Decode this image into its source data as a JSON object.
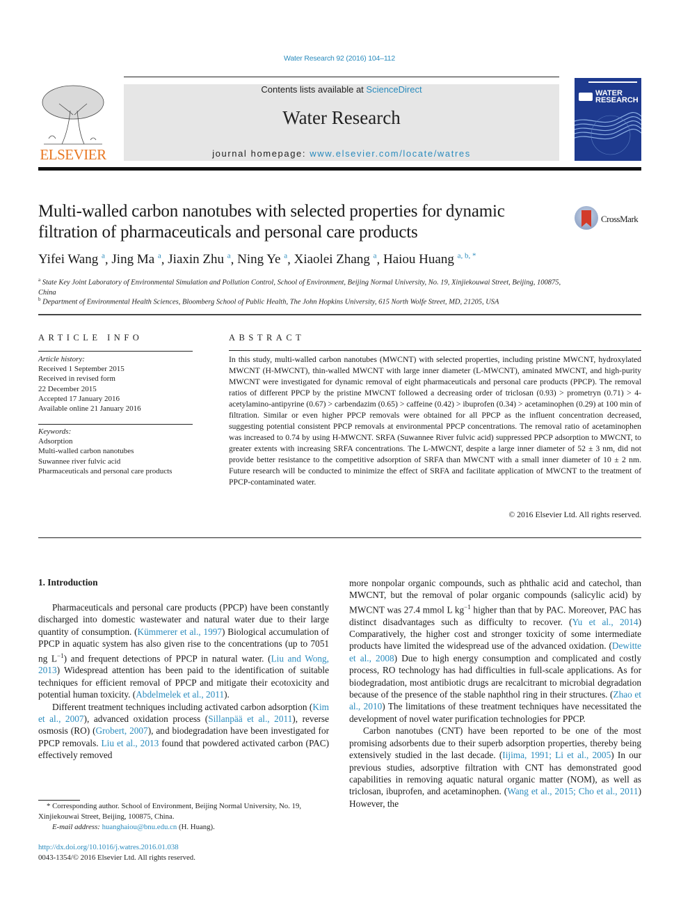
{
  "header": {
    "journal_citation": "Water Research 92 (2016) 104–112",
    "contents_prefix": "Contents lists available at ",
    "contents_link": "ScienceDirect",
    "journal_title": "Water Research",
    "homepage_prefix": "journal homepage: ",
    "homepage_link": "www.elsevier.com/locate/watres",
    "publisher_logo_text": "ELSEVIER",
    "cover_title_line1": "WATER",
    "cover_title_line2": "RESEARCH",
    "crossmark_label": "CrossMark"
  },
  "article": {
    "title": "Multi-walled carbon nanotubes with selected properties for dynamic filtration of pharmaceuticals and personal care products",
    "authors": [
      {
        "name": "Yifei Wang",
        "aff": "a"
      },
      {
        "name": "Jing Ma",
        "aff": "a"
      },
      {
        "name": "Jiaxin Zhu",
        "aff": "a"
      },
      {
        "name": "Ning Ye",
        "aff": "a"
      },
      {
        "name": "Xiaolei Zhang",
        "aff": "a"
      },
      {
        "name": "Haiou Huang",
        "aff": "a, b, *"
      }
    ],
    "affiliations": [
      {
        "key": "a",
        "text": "State Key Joint Laboratory of Environmental Simulation and Pollution Control, School of Environment, Beijing Normal University, No. 19, Xinjiekouwai Street, Beijing, 100875, China"
      },
      {
        "key": "b",
        "text": "Department of Environmental Health Sciences, Bloomberg School of Public Health, The John Hopkins University, 615 North Wolfe Street, MD, 21205, USA"
      }
    ]
  },
  "article_info": {
    "heading": "ARTICLE INFO",
    "history_label": "Article history:",
    "history": [
      "Received 1 September 2015",
      "Received in revised form",
      "22 December 2015",
      "Accepted 17 January 2016",
      "Available online 21 January 2016"
    ],
    "keywords_label": "Keywords:",
    "keywords": [
      "Adsorption",
      "Multi-walled carbon nanotubes",
      "Suwannee river fulvic acid",
      "Pharmaceuticals and personal care products"
    ]
  },
  "abstract": {
    "heading": "ABSTRACT",
    "text": "In this study, multi-walled carbon nanotubes (MWCNT) with selected properties, including pristine MWCNT, hydroxylated MWCNT (H-MWCNT), thin-walled MWCNT with large inner diameter (L-MWCNT), aminated MWCNT, and high-purity MWCNT were investigated for dynamic removal of eight pharmaceuticals and personal care products (PPCP). The removal ratios of different PPCP by the pristine MWCNT followed a decreasing order of triclosan (0.93) > prometryn (0.71) > 4-acetylamino-antipyrine (0.67) > carbendazim (0.65) > caffeine (0.42) > ibuprofen (0.34) > acetaminophen (0.29) at 100 min of filtration. Similar or even higher PPCP removals were obtained for all PPCP as the influent concentration decreased, suggesting potential consistent PPCP removals at environmental PPCP concentrations. The removal ratio of acetaminophen was increased to 0.74 by using H-MWCNT. SRFA (Suwannee River fulvic acid) suppressed PPCP adsorption to MWCNT, to greater extents with increasing SRFA concentrations. The L-MWCNT, despite a large inner diameter of 52 ± 3 nm, did not provide better resistance to the competitive adsorption of SRFA than MWCNT with a small inner diameter of 10 ± 2 nm. Future research will be conducted to minimize the effect of SRFA and facilitate application of MWCNT to the treatment of PPCP-contaminated water.",
    "copyright": "© 2016 Elsevier Ltd. All rights reserved."
  },
  "introduction": {
    "heading": "1.  Introduction",
    "left_paragraphs": [
      [
        {
          "t": "Pharmaceuticals and personal care products (PPCP) have been constantly discharged into domestic wastewater and natural water due to their large quantity of consumption. ("
        },
        {
          "l": "Kümmerer et al., 1997"
        },
        {
          "t": ") Biological accumulation of PPCP in aquatic system has also given rise to the concentrations (up to 7051 ng L"
        },
        {
          "sup": "−1"
        },
        {
          "t": ") and frequent detections of PPCP in natural water. ("
        },
        {
          "l": "Liu and Wong, 2013"
        },
        {
          "t": ") Widespread attention has been paid to the identification of suitable techniques for efficient removal of PPCP and mitigate their ecotoxicity and potential human toxicity. ("
        },
        {
          "l": "Abdelmelek et al., 2011"
        },
        {
          "t": ")."
        }
      ],
      [
        {
          "t": "Different treatment techniques including activated carbon adsorption ("
        },
        {
          "l": "Kim et al., 2007"
        },
        {
          "t": "), advanced oxidation process ("
        },
        {
          "l": "Sillanpää et al., 2011"
        },
        {
          "t": "), reverse osmosis (RO) ("
        },
        {
          "l": "Grobert, 2007"
        },
        {
          "t": "), and biodegradation have been investigated for PPCP removals. "
        },
        {
          "l": "Liu et al., 2013"
        },
        {
          "t": " found that powdered activated carbon (PAC) effectively removed"
        }
      ]
    ],
    "right_paragraphs": [
      [
        {
          "t": "more nonpolar organic compounds, such as phthalic acid and catechol, than MWCNT, but the removal of polar organic compounds (salicylic acid) by MWCNT was 27.4 mmol L kg"
        },
        {
          "sup": "−1"
        },
        {
          "t": " higher than that by PAC. Moreover, PAC has distinct disadvantages such as difficulty to recover. ("
        },
        {
          "l": "Yu et al., 2014"
        },
        {
          "t": ") Comparatively, the higher cost and stronger toxicity of some intermediate products have limited the widespread use of the advanced oxidation. ("
        },
        {
          "l": "Dewitte et al., 2008"
        },
        {
          "t": ") Due to high energy consumption and complicated and costly process, RO technology has had difficulties in full-scale applications. As for biodegradation, most antibiotic drugs are recalcitrant to microbial degradation because of the presence of the stable naphthol ring in their structures. ("
        },
        {
          "l": "Zhao et al., 2010"
        },
        {
          "t": ") The limitations of these treatment techniques have necessitated the development of novel water purification technologies for PPCP."
        }
      ],
      [
        {
          "t": "Carbon nanotubes (CNT) have been reported to be one of the most promising adsorbents due to their superb adsorption properties, thereby being extensively studied in the last decade. ("
        },
        {
          "l": "Iijima, 1991; Li et al., 2005"
        },
        {
          "t": ") In our previous studies, adsorptive filtration with CNT has demonstrated good capabilities in removing aquatic natural organic matter (NOM), as well as triclosan, ibuprofen, and acetaminophen. ("
        },
        {
          "l": "Wang et al., 2015; Cho et al., 2011"
        },
        {
          "t": ") However, the"
        }
      ]
    ]
  },
  "footnote": {
    "corresponding": "* Corresponding author. School of Environment, Beijing Normal University, No. 19, Xinjiekouwai Street, Beijing, 100875, China.",
    "email_label": "E-mail address: ",
    "email": "huanghaiou@bnu.edu.cn",
    "email_suffix": " (H. Huang).",
    "doi": "http://dx.doi.org/10.1016/j.watres.2016.01.038",
    "issn_line": "0043-1354/© 2016 Elsevier Ltd. All rights reserved."
  }
}
